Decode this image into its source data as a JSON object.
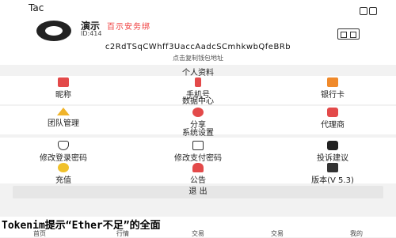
{
  "status": {
    "title": "Tac"
  },
  "profile": {
    "name": "演示",
    "badge": "百示安务绑",
    "id": "ID:414",
    "address": "c2RdTSqCWhff3UaccAadcSCmhkwbQfeBRb",
    "hint": "点击复制钱包地址"
  },
  "sections": {
    "personal": "个人资料",
    "data": "数据中心",
    "system": "系统设置"
  },
  "personal": [
    {
      "label": "昵称",
      "icon": "id-card-icon"
    },
    {
      "label": "手机号",
      "icon": "phone-icon"
    },
    {
      "label": "银行卡",
      "icon": "bank-card-icon"
    }
  ],
  "data": [
    {
      "label": "团队管理",
      "icon": "crown-icon"
    },
    {
      "label": "分享",
      "icon": "share-icon"
    },
    {
      "label": "代理商",
      "icon": "agent-icon"
    }
  ],
  "system1": [
    {
      "label": "修改登录密码",
      "icon": "shield-icon"
    },
    {
      "label": "修改支付密码",
      "icon": "lock-icon"
    },
    {
      "label": "投诉建议",
      "icon": "chat-icon"
    }
  ],
  "system2": [
    {
      "label": "充值",
      "icon": "coin-icon"
    },
    {
      "label": "公告",
      "icon": "bell-icon"
    },
    {
      "label": "版本(V 5.3)",
      "icon": "download-icon"
    }
  ],
  "logout": "退 出",
  "banner": "Tokenim提示“Ether不足”的全面",
  "tabs": [
    "首页",
    "行情",
    "交易",
    "交易",
    "我的"
  ]
}
